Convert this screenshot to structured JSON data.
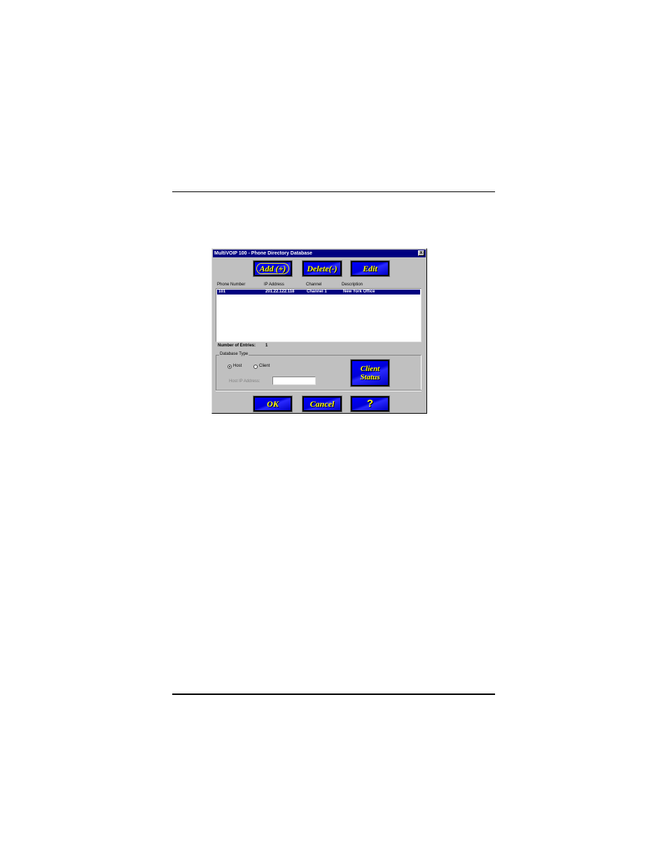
{
  "dialog": {
    "title": "MultiVOIP 100 - Phone Directory Database",
    "close_label": "x"
  },
  "toolbar": {
    "add_label": "Add (+)",
    "delete_label": "Delete(-)",
    "edit_label": "Edit"
  },
  "table": {
    "columns": [
      "Phone Number",
      "IP Address",
      "Channel",
      "Description"
    ],
    "rows": [
      {
        "phone": "101",
        "ip": "201.22.122.118",
        "channel": "Channel 1",
        "description": "New York Office",
        "selected": true
      }
    ]
  },
  "entries": {
    "label": "Number of Entries:",
    "value": "1"
  },
  "database_type": {
    "label": "Database Type",
    "options": [
      "Host",
      "Client"
    ],
    "selected": "Host",
    "host_ip_label": "Host IP Address:",
    "host_ip_value": ""
  },
  "client_status": {
    "line1": "Client",
    "line2": "Status"
  },
  "footer": {
    "ok_label": "OK",
    "cancel_label": "Cancel",
    "help_label": "?"
  },
  "colors": {
    "button_face": "#0000ff",
    "button_text": "#ffff00",
    "title_bar": "#000080",
    "dialog_bg": "#c0c0c0"
  }
}
